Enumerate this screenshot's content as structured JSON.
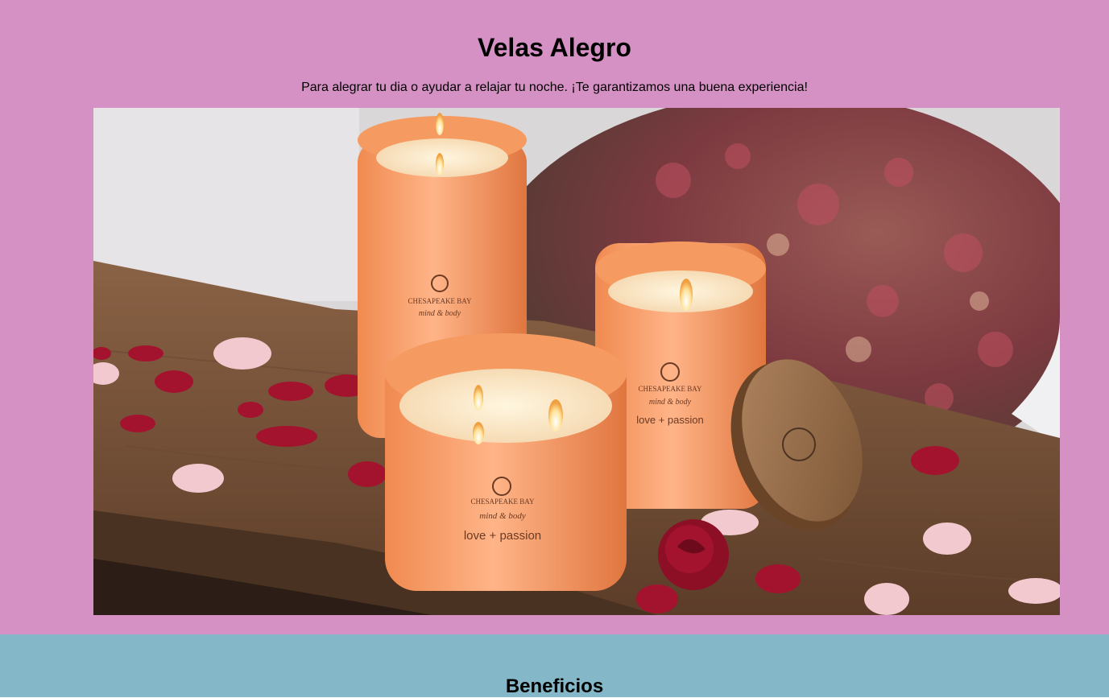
{
  "header": {
    "title": "Velas Alegro",
    "tagline": "Para alegrar tu dia o ayudar a relajar tu noche. ¡Te garantizamos una buena experiencia!"
  },
  "hero_image": {
    "alt": "Velas Alegro",
    "jar_labels": {
      "brand": "CHESAPEAKE BAY",
      "line": "mind & body",
      "scent": "love + passion"
    }
  },
  "benefits": {
    "title": "Beneficios"
  },
  "colors": {
    "hero_bg": "#d591c4",
    "benefits_bg": "#84b8c9",
    "candle_glass": "#f4935c",
    "wood": "#7a5439",
    "petal": "#a3132e"
  }
}
